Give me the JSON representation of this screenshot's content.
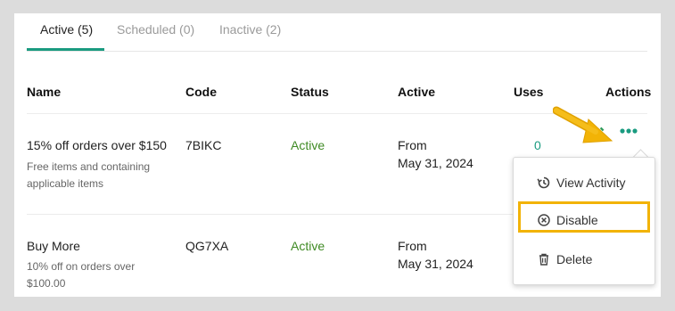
{
  "tabs": [
    {
      "label": "Active (5)"
    },
    {
      "label": "Scheduled (0)"
    },
    {
      "label": "Inactive (2)"
    }
  ],
  "columns": {
    "name": "Name",
    "code": "Code",
    "status": "Status",
    "active": "Active",
    "uses": "Uses",
    "actions": "Actions"
  },
  "rows": [
    {
      "name": "15% off orders over $150",
      "description": "Free items and containing applicable items",
      "code": "7BIKC",
      "status": "Active",
      "active_from": "From",
      "active_date": "May 31, 2024",
      "uses": "0"
    },
    {
      "name": "Buy More",
      "description": "10% off on orders over $100.00",
      "code": "QG7XA",
      "status": "Active",
      "active_from": "From",
      "active_date": "May 31, 2024"
    }
  ],
  "menu": {
    "items": [
      {
        "label": "View Activity",
        "icon": "history-icon"
      },
      {
        "label": "Disable",
        "icon": "circle-x-icon"
      },
      {
        "label": "Delete",
        "icon": "trash-icon"
      }
    ]
  },
  "colors": {
    "accent": "#1a9b80",
    "status_active": "#3f8a24",
    "highlight": "#f2b306"
  }
}
